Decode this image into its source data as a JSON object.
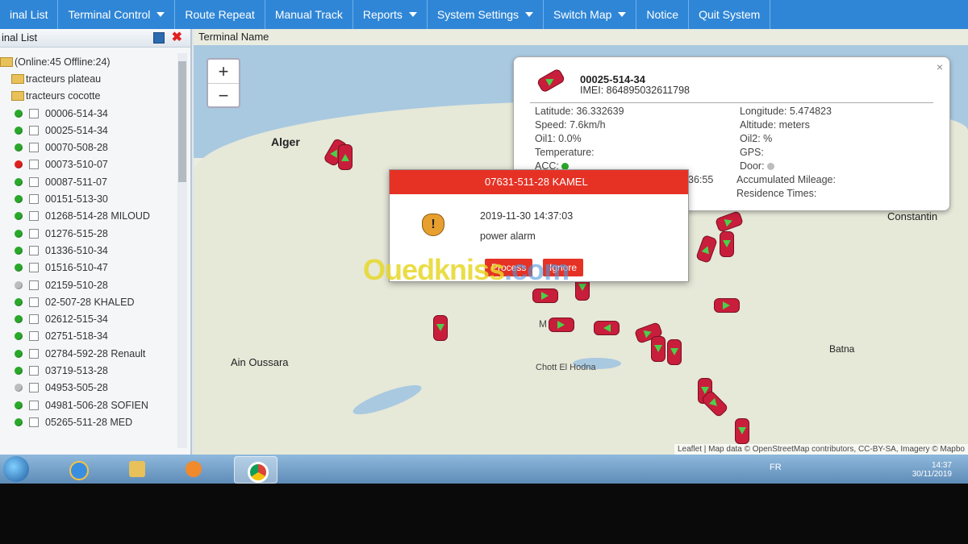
{
  "nav": {
    "items": [
      {
        "label": "inal List",
        "caret": false
      },
      {
        "label": "Terminal Control",
        "caret": true
      },
      {
        "label": "Route Repeat",
        "caret": false
      },
      {
        "label": "Manual Track",
        "caret": false
      },
      {
        "label": "Reports",
        "caret": true
      },
      {
        "label": "System Settings",
        "caret": true
      },
      {
        "label": "Switch Map",
        "caret": true
      },
      {
        "label": "Notice",
        "caret": false
      },
      {
        "label": "Quit System",
        "caret": false
      }
    ]
  },
  "left": {
    "title": "inal List",
    "summary": "(Online:45   Offline:24)",
    "groups": [
      "tracteurs plateau",
      "tracteurs cocotte"
    ],
    "terminals": [
      {
        "name": "00006-514-34",
        "status": "online"
      },
      {
        "name": "00025-514-34",
        "status": "online"
      },
      {
        "name": "00070-508-28",
        "status": "online"
      },
      {
        "name": "00073-510-07",
        "status": "offline"
      },
      {
        "name": "00087-511-07",
        "status": "online"
      },
      {
        "name": "00151-513-30",
        "status": "online"
      },
      {
        "name": "01268-514-28 MILOUD",
        "status": "online"
      },
      {
        "name": "01276-515-28",
        "status": "online"
      },
      {
        "name": "01336-510-34",
        "status": "online"
      },
      {
        "name": "01516-510-47",
        "status": "online"
      },
      {
        "name": "02159-510-28",
        "status": "idle"
      },
      {
        "name": "02-507-28 KHALED",
        "status": "online"
      },
      {
        "name": "02612-515-34",
        "status": "online"
      },
      {
        "name": "02751-518-34",
        "status": "online"
      },
      {
        "name": "02784-592-28 Renault",
        "status": "online"
      },
      {
        "name": "03719-513-28",
        "status": "online"
      },
      {
        "name": "04953-505-28",
        "status": "idle"
      },
      {
        "name": "04981-506-28 SOFIEN",
        "status": "online"
      },
      {
        "name": "05265-511-28 MED",
        "status": "online"
      }
    ]
  },
  "map": {
    "title": "Terminal Name",
    "zoom_in": "+",
    "zoom_out": "−",
    "cities": [
      "Alger",
      "Constantin",
      "Batna",
      "Ain Oussara"
    ],
    "small_labels": [
      "Chott El Hodna",
      "M"
    ],
    "attribution": "Leaflet | Map data © OpenStreetMap contributors, CC-BY-SA, Imagery © Mapbo"
  },
  "info": {
    "name": "00025-514-34",
    "imei": "IMEI: 864895032611798",
    "latitude": "Latitude: 36.332639",
    "longitude": "Longitude: 5.474823",
    "speed": "Speed: 7.6km/h",
    "altitude": "Altitude: meters",
    "oil1": "Oil1: 0.0%",
    "oil2": "Oil2: %",
    "temperature": "Temperature:",
    "gps": "GPS:",
    "acc": "ACC:",
    "door": "Door:",
    "time_tail": "36:55",
    "mileage": "Accumulated Mileage:",
    "residence": "Residence Times:",
    "close": "×",
    "acc_color": "#2aa82a",
    "door_color": "#bdbdbd"
  },
  "alarm": {
    "title": "07631-511-28 KAMEL",
    "time": "2019-11-30 14:37:03",
    "message": "power alarm",
    "process_label": "Process",
    "ignore_label": "Ignore",
    "icon_glyph": "!"
  },
  "watermark": {
    "part1": "Ouedkniss",
    "part2": ".com"
  },
  "taskbar": {
    "lang": "FR",
    "time": "14:37",
    "date": "30/11/2019"
  },
  "colors": {
    "nav": "#2f86d6",
    "alarm": "#e53225",
    "car": "#c81e3c"
  }
}
